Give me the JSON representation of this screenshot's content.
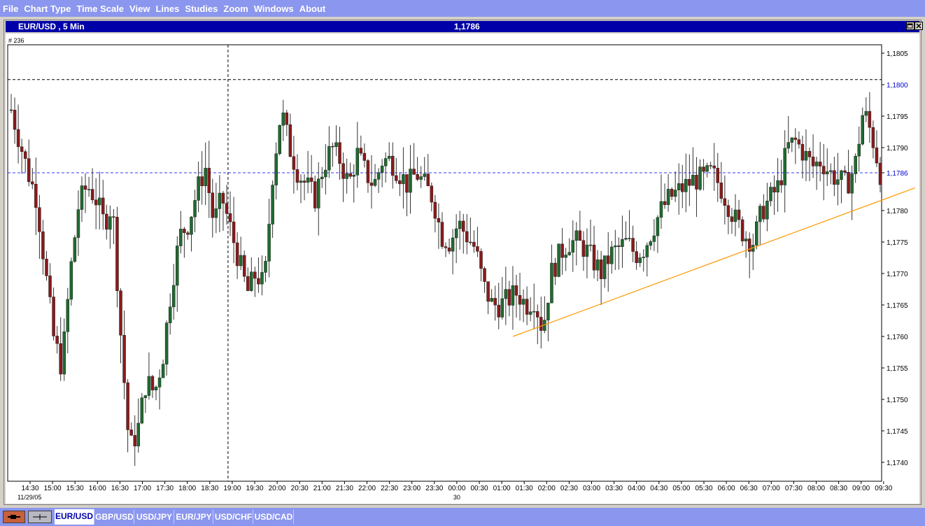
{
  "menu": [
    "File",
    "Chart Type",
    "Time Scale",
    "View",
    "Lines",
    "Studies",
    "Zoom",
    "Windows",
    "About"
  ],
  "window": {
    "title": "EUR/USD , 5 Min",
    "price": "1,1786",
    "bar_index": "# 236"
  },
  "tabs": [
    "EUR/USD",
    "GBP/USD",
    "USD/JPY",
    "EUR/JPY",
    "USD/CHF",
    "USD/CAD"
  ],
  "active_tab": "EUR/USD",
  "nav_icons": [
    "pin-icon",
    "crosshair-icon"
  ],
  "colors": {
    "bull": "#1e6b2e",
    "bear": "#8b1a1a",
    "hline": "#3333ff",
    "trendline": "#ff9900",
    "price_label": "#0000cc"
  },
  "chart_data": {
    "type": "candlestick",
    "symbol": "EUR/USD",
    "timeframe": "5 Min",
    "ylim": [
      1.1736,
      1.1808
    ],
    "yticks": [
      "1,1805",
      "1,1800",
      "1,1795",
      "1,1790",
      "1,1786",
      "1,1780",
      "1,1775",
      "1,1770",
      "1,1765",
      "1,1760",
      "1,1755",
      "1,1750",
      "1,1745",
      "1,1740"
    ],
    "highlighted_price": "1,1800",
    "current_price": "1,1786",
    "xticks": [
      "14:30",
      "15:00",
      "15:30",
      "16:00",
      "16:30",
      "17:00",
      "17:30",
      "18:00",
      "18:30",
      "19:00",
      "19:30",
      "20:00",
      "20:30",
      "21:00",
      "21:30",
      "22:00",
      "22:30",
      "23:00",
      "23:30",
      "00:00",
      "00:30",
      "01:00",
      "01:30",
      "02:00",
      "02:30",
      "03:00",
      "03:30",
      "04:00",
      "04:30",
      "05:00",
      "05:30",
      "06:00",
      "06:30",
      "07:00",
      "07:30",
      "08:00",
      "08:30",
      "09:00",
      "09:30"
    ],
    "date_labels": [
      "11/29/05",
      "30"
    ],
    "price_path": [
      1.1796,
      1.1791,
      1.1786,
      1.1782,
      1.1771,
      1.176,
      1.1755,
      1.177,
      1.1781,
      1.1784,
      1.1782,
      1.1778,
      1.1781,
      1.176,
      1.1742,
      1.1745,
      1.1753,
      1.1751,
      1.1757,
      1.1768,
      1.1776,
      1.1778,
      1.1783,
      1.1787,
      1.1778,
      1.1782,
      1.1777,
      1.1772,
      1.1767,
      1.177,
      1.1768,
      1.1786,
      1.1796,
      1.179,
      1.1786,
      1.1784,
      1.1782,
      1.1787,
      1.179,
      1.1788,
      1.1784,
      1.1789,
      1.1786,
      1.1784,
      1.1788,
      1.1788,
      1.1786,
      1.1784,
      1.1786,
      1.1784,
      1.1782,
      1.1776,
      1.1775,
      1.1778,
      1.1776,
      1.1774,
      1.1768,
      1.1765,
      1.1765,
      1.1766,
      1.1767,
      1.1765,
      1.1766,
      1.1761,
      1.177,
      1.1773,
      1.1775,
      1.1775,
      1.1774,
      1.1772,
      1.177,
      1.1773,
      1.1774,
      1.1775,
      1.1773,
      1.1774,
      1.1777,
      1.178,
      1.1782,
      1.1783,
      1.1784,
      1.1785,
      1.1785,
      1.1786,
      1.1784,
      1.1781,
      1.1778,
      1.1776,
      1.1775,
      1.178,
      1.1782,
      1.1784,
      1.179,
      1.1791,
      1.1789,
      1.1787,
      1.1788,
      1.1786,
      1.1785,
      1.1784,
      1.1787,
      1.1796,
      1.1792,
      1.1786
    ],
    "trendline": [
      {
        "t": 21.5,
        "price": 1.176
      },
      {
        "t": 39.4,
        "price": 1.17836
      }
    ],
    "vertical_marker": "19:00",
    "grid": false
  }
}
